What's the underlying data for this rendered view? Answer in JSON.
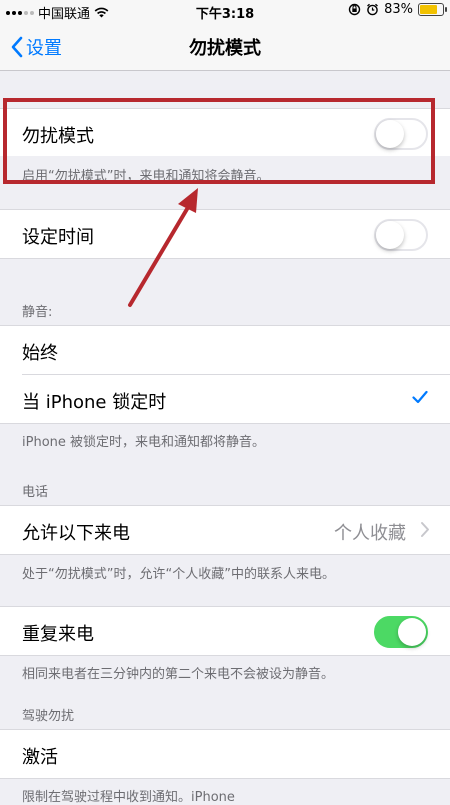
{
  "status": {
    "carrier": "中国联通",
    "time": "下午3:18",
    "battery_text": "83%",
    "battery_level": 0.83
  },
  "nav": {
    "back_label": "设置",
    "title": "勿扰模式"
  },
  "dnd": {
    "label": "勿扰模式",
    "enabled": false,
    "footnote": "启用“勿扰模式”时，来电和通知将会静音。"
  },
  "scheduled": {
    "label": "设定时间",
    "enabled": false
  },
  "silence": {
    "header": "静音:",
    "always_label": "始终",
    "locked_label": "当 iPhone 锁定时",
    "locked_selected": true,
    "footnote": "iPhone 被锁定时，来电和通知都将静音。"
  },
  "phone": {
    "header": "电话",
    "allow_calls_label": "允许以下来电",
    "allow_calls_value": "个人收藏",
    "footnote": "处于“勿扰模式”时，允许“个人收藏”中的联系人来电。",
    "repeated_label": "重复来电",
    "repeated_enabled": true,
    "repeated_footnote": "相同来电者在三分钟内的第二个来电不会被设为静音。"
  },
  "driving": {
    "header": "驾驶勿扰",
    "activate_label": "激活",
    "footnote": "限制在驾驶过程中收到通知。iPhone"
  },
  "colors": {
    "accent": "#007aff",
    "toggle_on": "#4cd964",
    "annotation": "#b7282e"
  }
}
